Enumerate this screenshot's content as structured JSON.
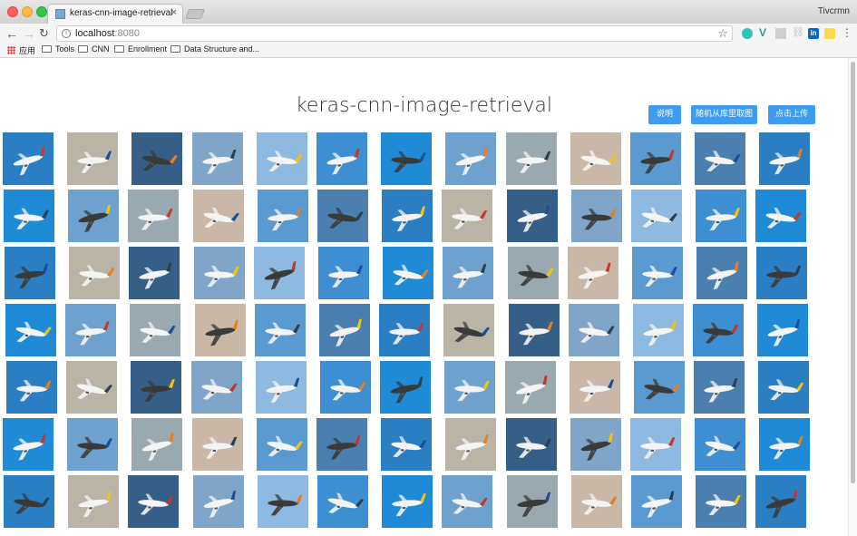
{
  "browser": {
    "tab_title": "keras-cnn-image-retrieval",
    "tab_close": "×",
    "profile_name": "Tivcrmn",
    "url_host": "localhost",
    "url_port": ":8080",
    "nav": {
      "back": "←",
      "forward": "→",
      "reload": "↻",
      "star": "☆",
      "menu": "⋮",
      "info": "i"
    },
    "extensions": {
      "linkedin": "in",
      "vue": "V"
    }
  },
  "bookmarks": [
    {
      "label": "应用",
      "icon": "apps-icon"
    },
    {
      "label": "Tools",
      "icon": "folder-icon"
    },
    {
      "label": "CNN",
      "icon": "folder-icon"
    },
    {
      "label": "Enrollment",
      "icon": "folder-icon"
    },
    {
      "label": "Data Structure and...",
      "icon": "folder-icon"
    }
  ],
  "page": {
    "title": "keras-cnn-image-retrieval",
    "buttons": {
      "help": "说明",
      "random": "随机从库里取图",
      "upload": "点击上传"
    }
  },
  "gallery": {
    "rows": 7,
    "cols": 13,
    "image_subject": "airplane-photo",
    "sky_colors": [
      "#2a7fc4",
      "#3d8fd1",
      "#5b9ad0",
      "#7fa6c9",
      "#9aa9b0",
      "#b9b4a6",
      "#1f8ad6",
      "#4a7fb0",
      "#8eb9e0",
      "#c9b8a8",
      "#355f86",
      "#6fa1cf"
    ]
  }
}
